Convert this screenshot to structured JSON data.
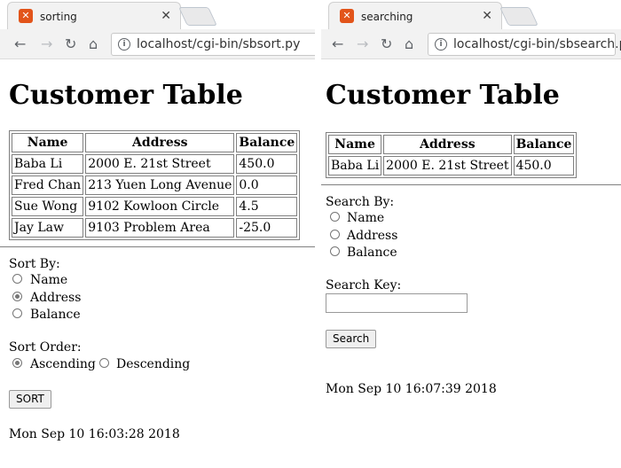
{
  "left_window": {
    "tab_title": "sorting",
    "url": "localhost/cgi-bin/sbsort.py",
    "heading": "Customer Table",
    "table": {
      "headers": [
        "Name",
        "Address",
        "Balance"
      ],
      "rows": [
        [
          "Baba Li",
          "2000 E. 21st Street",
          "450.0"
        ],
        [
          "Fred Chan",
          "213 Yuen Long Avenue",
          "0.0"
        ],
        [
          "Sue Wong",
          "9102 Kowloon Circle",
          "4.5"
        ],
        [
          "Jay Law",
          "9103 Problem Area",
          "-25.0"
        ]
      ]
    },
    "sort_by_label": "Sort By:",
    "sort_by_options": [
      "Name",
      "Address",
      "Balance"
    ],
    "sort_by_selected": "Address",
    "sort_order_label": "Sort Order:",
    "sort_order_options": [
      "Ascending",
      "Descending"
    ],
    "sort_order_selected": "Ascending",
    "submit_label": "SORT",
    "timestamp": "Mon Sep 10 16:03:28 2018"
  },
  "right_window": {
    "tab_title": "searching",
    "url": "localhost/cgi-bin/sbsearch.py",
    "heading": "Customer Table",
    "table": {
      "headers": [
        "Name",
        "Address",
        "Balance"
      ],
      "rows": [
        [
          "Baba Li",
          "2000 E. 21st Street",
          "450.0"
        ]
      ]
    },
    "search_by_label": "Search By:",
    "search_by_options": [
      "Name",
      "Address",
      "Balance"
    ],
    "search_by_selected": "",
    "search_key_label": "Search Key:",
    "search_key_value": "",
    "submit_label": "Search",
    "timestamp": "Mon Sep 10 16:07:39 2018"
  },
  "icons": {
    "favicon": "xampp-icon",
    "close": "close-icon",
    "back": "back-arrow-icon",
    "forward": "forward-arrow-icon",
    "reload": "reload-icon",
    "home": "home-icon",
    "info": "info-icon"
  }
}
